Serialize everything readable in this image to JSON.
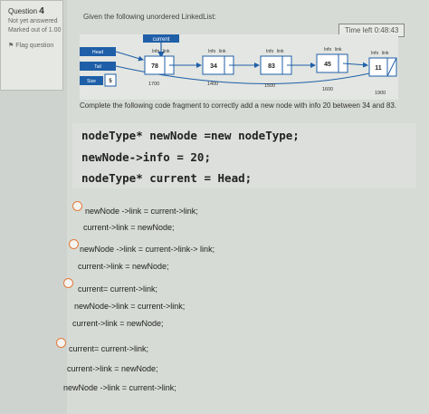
{
  "sidebar": {
    "question_label": "Question",
    "question_number": "4",
    "status": "Not yet answered",
    "marks": "Marked out of 1.00",
    "flag": "Flag question"
  },
  "header": {
    "prompt": "Given the following unordered LinkedList:",
    "timer": "Time left 0:48:43"
  },
  "diagram": {
    "current_label": "current",
    "head_label": "Head",
    "tail_label": "Tail",
    "size_label": "Size",
    "size_value": "5",
    "info_label": "Info",
    "link_label": "link",
    "nodes": [
      {
        "info": "78",
        "address": "1700"
      },
      {
        "info": "34",
        "address": "1400"
      },
      {
        "info": "83",
        "address": "1500"
      },
      {
        "info": "45",
        "address": "1600"
      },
      {
        "info": "11",
        "address": "1900"
      }
    ]
  },
  "question": {
    "text": "Complete the following code fragment to correctly add a new node with info 20 between 34 and 83."
  },
  "code": [
    "nodeType* newNode =new nodeType;",
    "newNode->info = 20;",
    "nodeType* current = Head;"
  ],
  "options": [
    {
      "lines": [
        "newNode ->link = current->link;",
        "current->link = newNode;"
      ]
    },
    {
      "lines": [
        "newNode ->link = current->link-> link;",
        "current->link = newNode;"
      ]
    },
    {
      "lines": [
        "current= current->link;",
        "newNode->link = current->link;",
        "current->link = newNode;"
      ]
    },
    {
      "lines": [
        "current= current->link;",
        "current->link = newNode;",
        "newNode ->link = current->link;"
      ]
    }
  ],
  "colors": {
    "diagram_blue": "#1f5fa8",
    "radio_border": "#e47b3a"
  }
}
